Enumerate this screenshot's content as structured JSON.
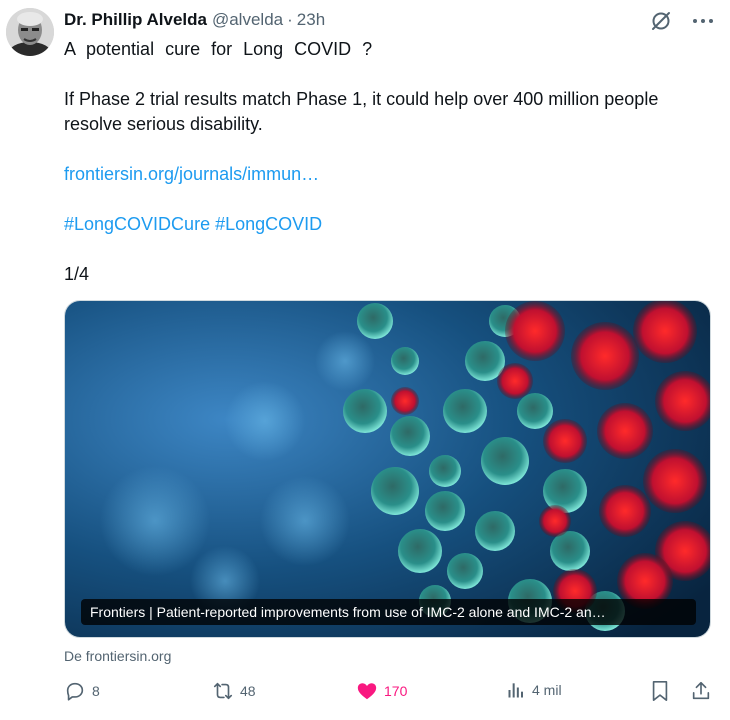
{
  "post": {
    "author": {
      "display_name": "Dr. Phillip Alvelda",
      "handle": "@alvelda",
      "separator": "·",
      "time": "23h"
    },
    "text": {
      "line1": "A potential cure for Long COVID ?",
      "line2": "If Phase 2 trial results match Phase 1, it could help over 400 million people",
      "line3": "resolve serious disability.",
      "link": "frontiersin.org/journals/immun…",
      "hashtag1": "#LongCOVIDCure",
      "hashtag2": "#LongCOVID",
      "counter": "1/4"
    },
    "card": {
      "caption": "Frontiers | Patient-reported improvements from use of IMC-2 alone and IMC-2 an…",
      "source": "De frontiersin.org"
    },
    "actions": {
      "replies": "8",
      "reposts": "48",
      "likes": "170",
      "views": "4 mil"
    },
    "icons": {
      "top": [
        "mute-icon",
        "more-icon"
      ],
      "actions": [
        "reply-icon",
        "repost-icon",
        "heart-icon",
        "views-icon",
        "bookmark-icon",
        "share-icon"
      ]
    },
    "colors": {
      "link": "#1d9bf0",
      "muted": "#536471",
      "like": "#f91880"
    }
  }
}
